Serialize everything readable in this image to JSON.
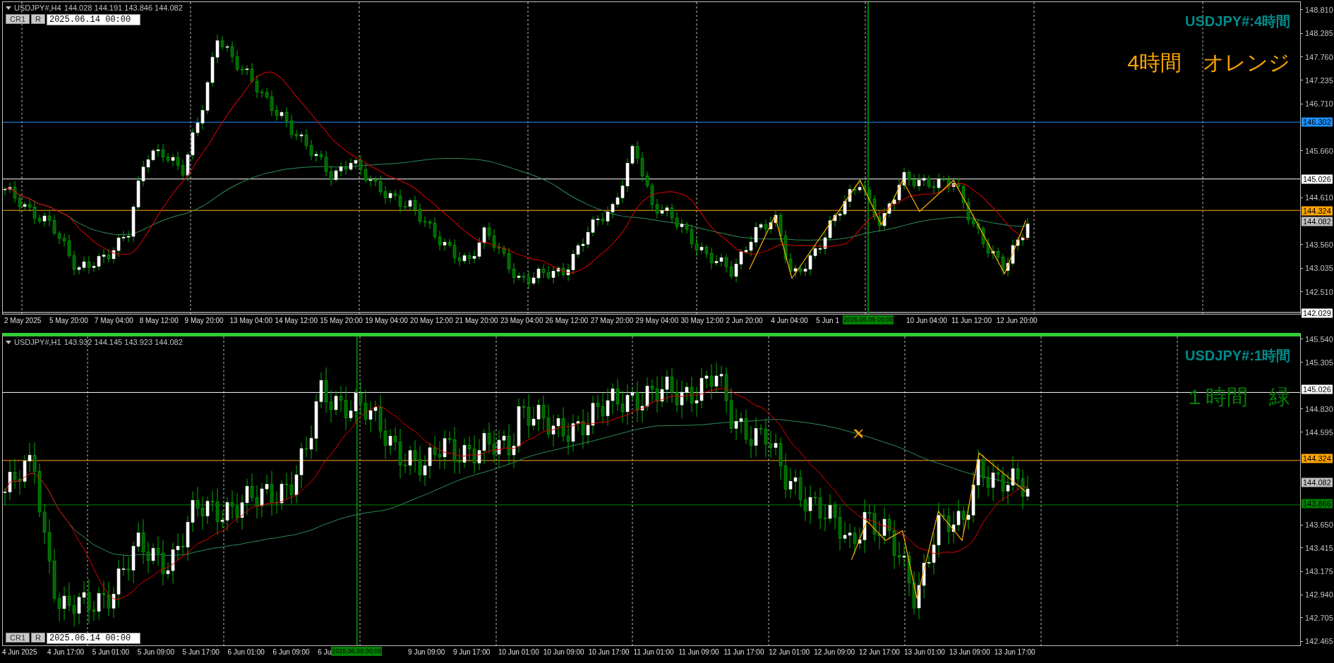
{
  "charts": [
    {
      "active": false,
      "header": {
        "symbol": "USDJPY#,H4",
        "prices": "144.028 144.191 143.846 144.082"
      },
      "toolbar": {
        "buttons": [
          "CR1",
          "R"
        ],
        "date": "2025.06.14 00:00"
      },
      "title": "USDJPY#:4時間",
      "note": {
        "text": "4時間　オレンジ",
        "color": "#ffa500"
      },
      "ticks": [
        "148.810",
        "148.285",
        "147.760",
        "147.235",
        "146.710",
        "145.660",
        "144.610",
        "143.560",
        "143.035",
        "142.510"
      ],
      "levels": [
        {
          "label": "146.302",
          "color": "#1e90ff",
          "kind": "line"
        },
        {
          "label": "145.026",
          "color": "#ffffff",
          "kind": "line"
        },
        {
          "label": "144.324",
          "color": "#ffa500",
          "kind": "line"
        },
        {
          "label": "144.082",
          "color": "#c0c0c0",
          "kind": "bid"
        },
        {
          "label": "142.029",
          "color": "#ffffff",
          "kind": "line"
        }
      ],
      "time_labels": [
        "2 May 2025",
        "5 May 20:00",
        "7 May 04:00",
        "8 May 12:00",
        "9 May 20:00",
        "13 May 04:00",
        "14 May 12:00",
        "15 May 20:00",
        "19 May 04:00",
        "20 May 12:00",
        "21 May 20:00",
        "23 May 04:00",
        "26 May 12:00",
        "27 May 20:00",
        "29 May 04:00",
        "30 May 12:00",
        "2 Jun 20:00",
        "4 Jun 04:00",
        "5 Jun 1",
        "10 Jun 04:00",
        "11 Jun 12:00",
        "12 Jun 20:00"
      ],
      "cursor_label": "2025.06.09 00:00"
    },
    {
      "active": true,
      "header": {
        "symbol": "USDJPY#,H1",
        "prices": "143.932 144.145 143.923 144.082"
      },
      "toolbar": {
        "buttons": [
          "CR1",
          "R"
        ],
        "date": "2025.06.14 00:00"
      },
      "title": "USDJPY#:1時間",
      "note": {
        "text": "１時間　緑",
        "color": "#008000"
      },
      "ticks": [
        "145.540",
        "145.305",
        "144.830",
        "144.595",
        "143.650",
        "143.415",
        "143.175",
        "142.940",
        "142.705",
        "142.465"
      ],
      "levels": [
        {
          "label": "145.026",
          "color": "#ffffff",
          "kind": "line"
        },
        {
          "label": "144.324",
          "color": "#ffa500",
          "kind": "line"
        },
        {
          "label": "144.082",
          "color": "#c0c0c0",
          "kind": "bid"
        },
        {
          "label": "143.866",
          "color": "#008000",
          "kind": "line"
        }
      ],
      "time_labels": [
        "4 Jun 2025",
        "4 Jun 17:00",
        "5 Jun 01:00",
        "5 Jun 09:00",
        "5 Jun 17:00",
        "6 Jun 01:00",
        "6 Jun 09:00",
        "6 Ju",
        "9 Jun 09:00",
        "9 Jun 17:00",
        "10 Jun 01:00",
        "10 Jun 09:00",
        "10 Jun 17:00",
        "11 Jun 01:00",
        "11 Jun 09:00",
        "11 Jun 17:00",
        "12 Jun 01:00",
        "12 Jun 09:00",
        "12 Jun 17:00",
        "13 Jun 01:00",
        "13 Jun 09:00",
        "13 Jun 17:00"
      ],
      "cursor_label": "2025.06.09 00:00"
    }
  ]
}
